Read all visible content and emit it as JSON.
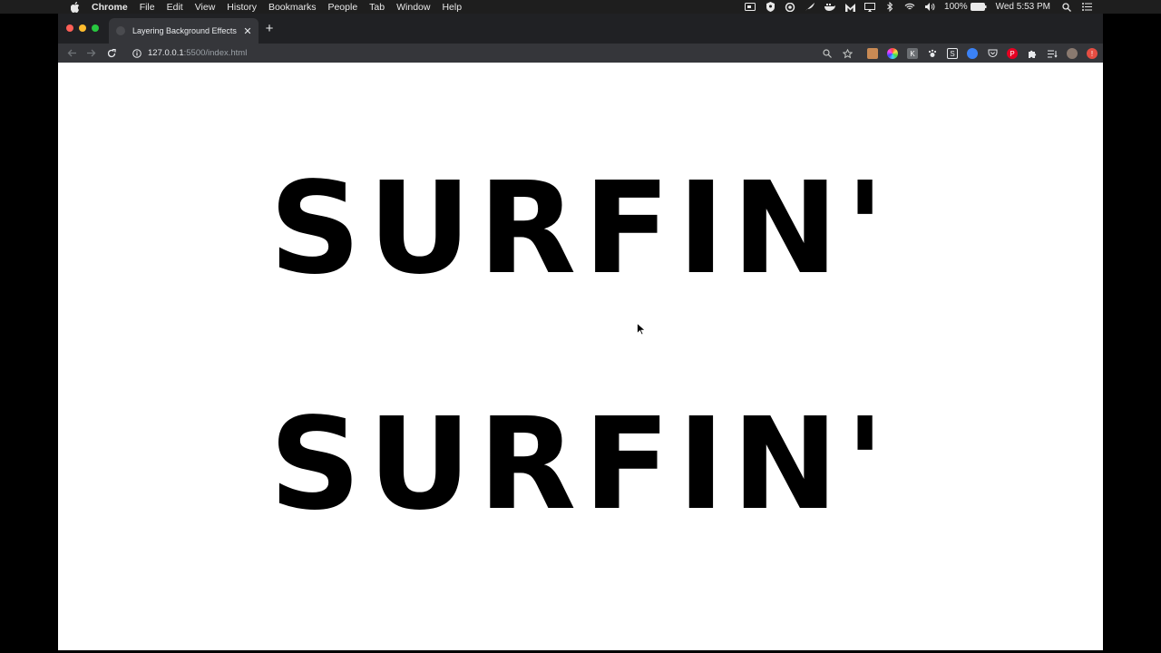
{
  "menubar": {
    "app_name": "Chrome",
    "items": [
      "File",
      "Edit",
      "View",
      "History",
      "Bookmarks",
      "People",
      "Tab",
      "Window",
      "Help"
    ],
    "battery": "100%",
    "clock": "Wed 5:53 PM"
  },
  "browser": {
    "tab_title": "Layering Background Effects",
    "url_host": "127.0.0.1",
    "url_path": ":5500/index.html"
  },
  "page": {
    "heading_1": "SURFIN'",
    "heading_2": "SURFIN'"
  }
}
